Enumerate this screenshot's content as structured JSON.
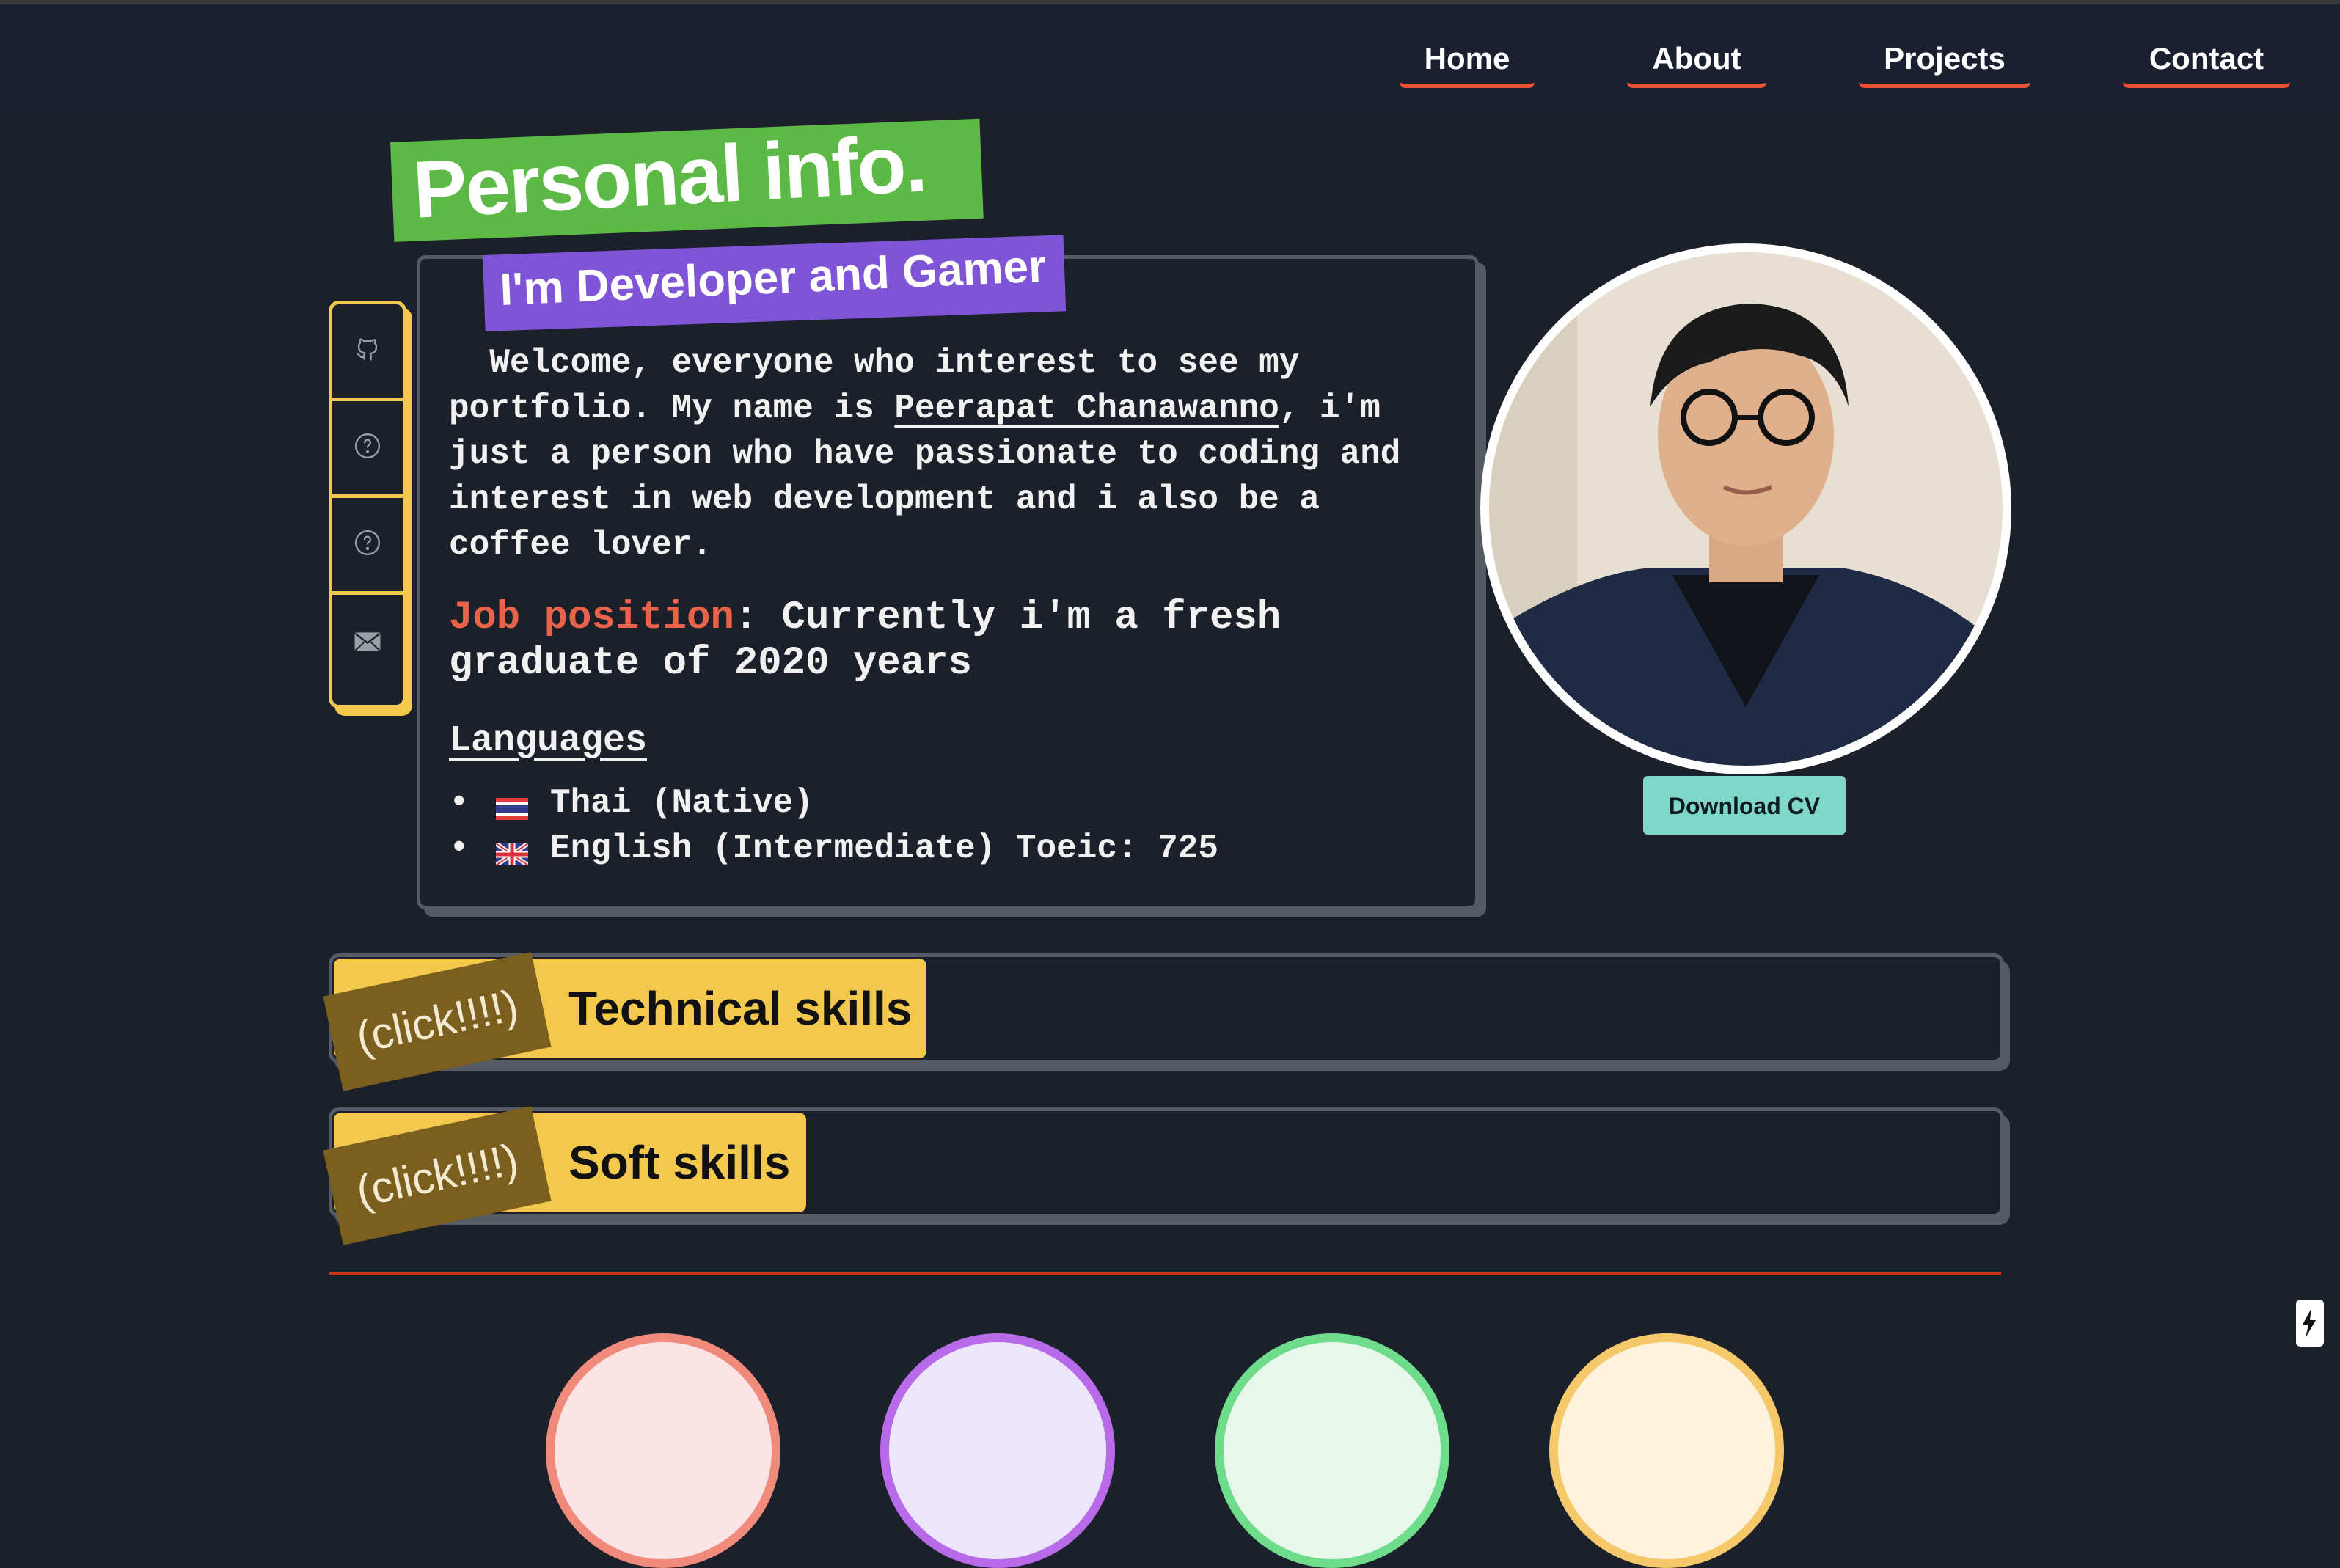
{
  "nav": {
    "items": [
      {
        "label": "Home"
      },
      {
        "label": "About"
      },
      {
        "label": "Projects"
      },
      {
        "label": "Contact"
      }
    ],
    "underline_color": "#e8523a"
  },
  "hero": {
    "title": "Personal info.",
    "subtitle": "I'm Developer and Gamer"
  },
  "sidebar": {
    "icons": [
      "github-icon",
      "question-icon",
      "question-icon",
      "mail-icon"
    ]
  },
  "intro": {
    "text_before": "  Welcome, everyone who interest to see my portfolio. My name is ",
    "name": "Peerapat Chanawanno",
    "text_after": ", i'm just a person who have passionate to coding and interest in web development and i also be a coffee lover."
  },
  "job": {
    "label": "Job position",
    "text": ": Currently i'm a fresh graduate of 2020 years"
  },
  "languages": {
    "heading": "Languages",
    "items": [
      {
        "flag": "thailand-flag-icon",
        "text": "Thai (Native)"
      },
      {
        "flag": "uk-flag-icon",
        "text": "English (Intermediate) Toeic: 725"
      }
    ]
  },
  "profile": {
    "download_label": "Download CV"
  },
  "skills": [
    {
      "tag": "(click!!!!)",
      "label": "Technical skills"
    },
    {
      "tag": "(click!!!!)",
      "label": "Soft skills"
    }
  ],
  "colors": {
    "background": "#1b202b",
    "navbar": "#1a2030",
    "title_banner": "#5cb946",
    "subtitle_banner": "#7f54d6",
    "accent_yellow": "#f2c94c",
    "job_label": "#e8634a",
    "download_button": "#7fd7c8",
    "divider": "#c9331e"
  },
  "bottom_circles": [
    "#f08a7a",
    "#b96ae8",
    "#6edc8a",
    "#f5c96a"
  ]
}
